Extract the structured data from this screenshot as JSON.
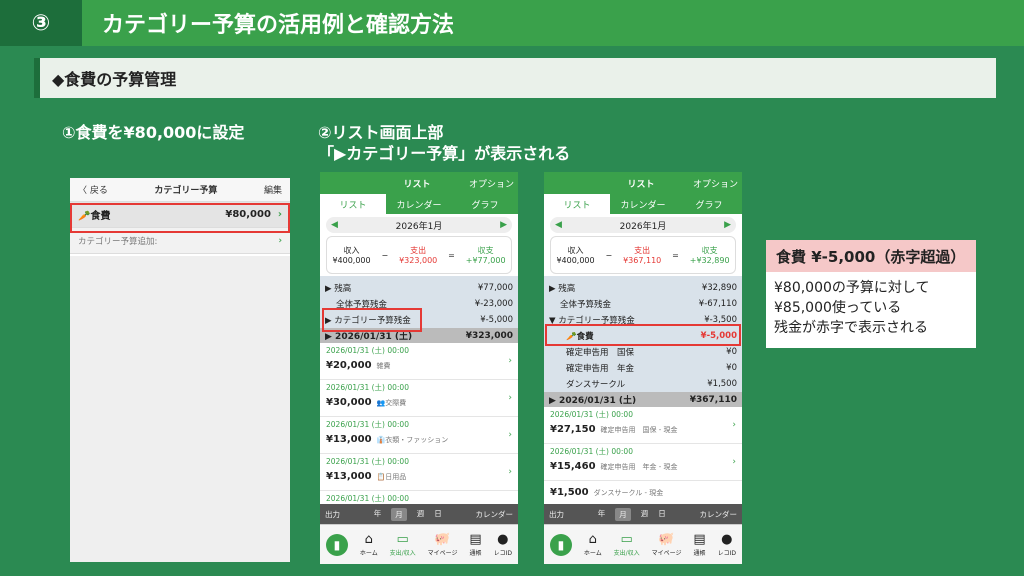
{
  "header": {
    "num": "③",
    "title": "カテゴリー予算の活用例と確認方法"
  },
  "section": {
    "title": "◆食費の予算管理"
  },
  "captions": {
    "c1": "①食費を¥80,000に設定",
    "c2a": "②リスト画面上部",
    "c2b": "「▶カテゴリー予算」が表示される"
  },
  "s1": {
    "back": "〈 戻る",
    "title": "カテゴリー予算",
    "edit": "編集",
    "row_label": "🥕食費",
    "row_value": "¥80,000",
    "add": "カテゴリー予算追加:"
  },
  "app": {
    "top_title": "リスト",
    "top_option": "オプション",
    "tabs": [
      "リスト",
      "カレンダー",
      "グラフ"
    ],
    "month": "2026年1月",
    "labels": {
      "income": "収入",
      "expense": "支出",
      "balance": "収支",
      "minus": "−",
      "equals": "="
    },
    "period": {
      "label": "出力",
      "items": [
        "年",
        "月",
        "週",
        "日"
      ],
      "calendar": "カレンダー"
    },
    "nav": [
      "ホーム",
      "支出/収入",
      "マイページ",
      "通帳",
      "レコID"
    ],
    "nav_icons": [
      "⌂",
      "▭",
      "🐖",
      "▤",
      "●"
    ]
  },
  "s2": {
    "income": "¥400,000",
    "expense": "¥323,000",
    "balance": "+¥77,000",
    "rows": [
      {
        "l": "▶ 残高",
        "v": "¥77,000"
      },
      {
        "l": "全体予算残金",
        "v": "¥-23,000"
      },
      {
        "l": "▶ カテゴリー予算残金",
        "v": "¥-5,000"
      }
    ],
    "date": "▶ 2026/01/31 (土)",
    "date_total": "¥323,000",
    "entries": [
      {
        "d": "2026/01/31 (土) 00:00",
        "a": "¥20,000",
        "c": "雑費"
      },
      {
        "d": "2026/01/31 (土) 00:00",
        "a": "¥30,000",
        "c": "👥交際費"
      },
      {
        "d": "2026/01/31 (土) 00:00",
        "a": "¥13,000",
        "c": "👔衣類・ファッション"
      },
      {
        "d": "2026/01/31 (土) 00:00",
        "a": "¥13,000",
        "c": "📋日用品"
      },
      {
        "d": "2026/01/31 (土) 00:00",
        "a": "",
        "c": ""
      }
    ]
  },
  "s3": {
    "income": "¥400,000",
    "expense": "¥367,110",
    "balance": "+¥32,890",
    "rows": [
      {
        "l": "▶ 残高",
        "v": "¥32,890"
      },
      {
        "l": "全体予算残金",
        "v": "¥-67,110"
      },
      {
        "l": "▼ カテゴリー予算残金",
        "v": "¥-3,500"
      }
    ],
    "food": {
      "l": "🥕食費",
      "v": "¥-5,000"
    },
    "rows2": [
      {
        "l": "確定申告用　国保",
        "v": "¥0"
      },
      {
        "l": "確定申告用　年金",
        "v": "¥0"
      },
      {
        "l": "ダンスサークル",
        "v": "¥1,500"
      }
    ],
    "date": "▶ 2026/01/31 (土)",
    "date_total": "¥367,110",
    "entries": [
      {
        "d": "2026/01/31 (土) 00:00",
        "a": "¥27,150",
        "c": "確定申告用　国保 - 現金"
      },
      {
        "d": "2026/01/31 (土) 00:00",
        "a": "¥15,460",
        "c": "確定申告用　年金 - 現金"
      },
      {
        "d": "",
        "a": "¥1,500",
        "c": "ダンスサークル - 現金"
      }
    ]
  },
  "callout": {
    "title": "食費 ¥-5,000（赤字超過）",
    "l1": "¥80,000の予算に対して",
    "l2": "¥85,000使っている",
    "l3": "残金が赤字で表示される"
  }
}
